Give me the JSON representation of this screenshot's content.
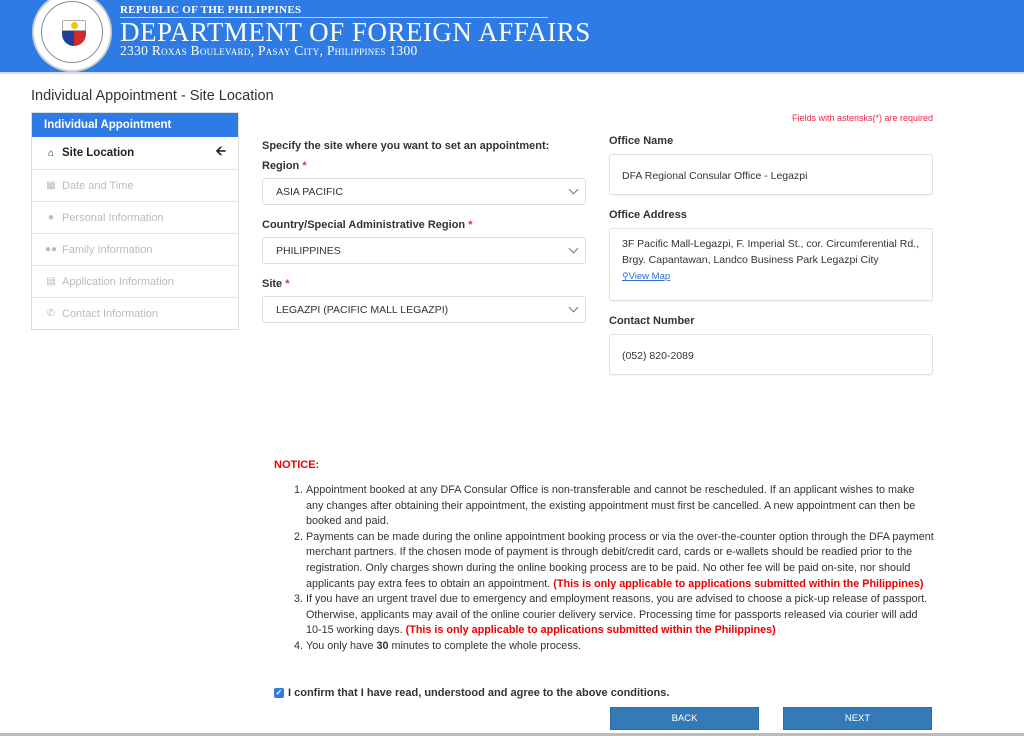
{
  "header": {
    "subtitle": "REPUBLIC OF THE PHILIPPINES",
    "title": "DEPARTMENT OF FOREIGN AFFAIRS",
    "address": "2330 Roxas Boulevard, Pasay City, Philippines 1300",
    "seal_icon": "dfa-seal-icon",
    "brand_color": "#2e7be6"
  },
  "page": {
    "title": "Individual Appointment - Site Location",
    "required_note": "Fields with asterisks(*) are required"
  },
  "sidebar": {
    "heading": "Individual Appointment",
    "items": [
      {
        "label": "Site Location",
        "icon": "home-icon",
        "active": true
      },
      {
        "label": "Date and Time",
        "icon": "calendar-icon",
        "active": false
      },
      {
        "label": "Personal Information",
        "icon": "user-icon",
        "active": false
      },
      {
        "label": "Family Information",
        "icon": "users-icon",
        "active": false
      },
      {
        "label": "Application Information",
        "icon": "list-icon",
        "active": false
      },
      {
        "label": "Contact Information",
        "icon": "phone-icon",
        "active": false
      }
    ]
  },
  "form": {
    "intro": "Specify the site where you want to set an appointment:",
    "region": {
      "label": "Region",
      "required": "*",
      "value": "ASIA PACIFIC"
    },
    "country": {
      "label": "Country/Special Administrative Region",
      "required": "*",
      "value": "PHILIPPINES"
    },
    "site": {
      "label": "Site",
      "required": "*",
      "value": "LEGAZPI (PACIFIC MALL LEGAZPI)"
    }
  },
  "office": {
    "name_label": "Office Name",
    "name": "DFA Regional Consular Office - Legazpi",
    "address_label": "Office Address",
    "address": "3F Pacific Mall-Legazpi, F. Imperial St., cor. Circumferential Rd., Brgy. Capantawan, Landco Business Park Legazpi City",
    "map_link": "View Map",
    "contact_label": "Contact Number",
    "contact": "(052) 820-2089"
  },
  "notice": {
    "title": "NOTICE:",
    "items": [
      {
        "text": "Appointment booked at any DFA Consular Office is non-transferable and cannot be rescheduled. If an applicant wishes to make any changes after obtaining their appointment, the existing appointment must first be cancelled. A new appointment can then be booked and paid.",
        "red": ""
      },
      {
        "text": "Payments can be made during the online appointment booking process or via the over-the-counter option through the DFA payment merchant partners. If the chosen mode of payment is through debit/credit card, cards or e-wallets should be readied prior to the registration. Only charges shown during the online booking process are to be paid. No other fee will be paid on-site, nor should applicants pay extra fees to obtain an appointment. ",
        "red": "(This is only applicable to applications submitted within the Philippines)"
      },
      {
        "text": "If you have an urgent travel due to emergency and employment reasons, you are advised to choose a pick-up release of passport. Otherwise, applicants may avail of the online courier delivery service. Processing time for passports released via courier will add 10-15 working days. ",
        "red": "(This is only applicable to applications submitted within the Philippines)"
      },
      {
        "text_before": "You only have ",
        "bold": "30",
        "text_after": " minutes to complete the whole process."
      }
    ]
  },
  "confirm": {
    "label": "I confirm that I have read, understood and agree to the above conditions.",
    "checked": true
  },
  "buttons": {
    "back": "BACK",
    "next": "NEXT"
  }
}
